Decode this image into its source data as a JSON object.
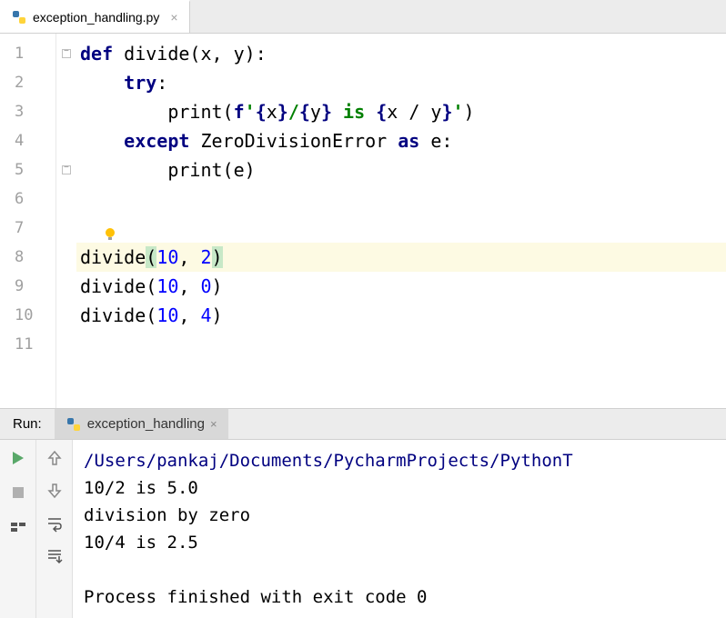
{
  "tabs": [
    {
      "label": "exception_handling.py"
    }
  ],
  "gutter_lines": [
    "1",
    "2",
    "3",
    "4",
    "5",
    "6",
    "7",
    "8",
    "9",
    "10",
    "11"
  ],
  "code": {
    "l1": {
      "def": "def",
      "name": "divide",
      "open": "(",
      "args": "x, y",
      "close": ")",
      "colon": ":"
    },
    "l2": {
      "try": "try",
      "colon": ":"
    },
    "l3": {
      "print": "print",
      "open": "(",
      "f": "f",
      "q1": "'",
      "br1": "{",
      "x": "x",
      "br2": "}",
      "slash": "/",
      "br3": "{",
      "y": "y",
      "br4": "}",
      "is": " is ",
      "br5": "{",
      "expr": "x / y",
      "br6": "}",
      "q2": "'",
      "close": ")"
    },
    "l4": {
      "except": "except",
      "exc": "ZeroDivisionError",
      "as": "as",
      "e": "e",
      "colon": ":"
    },
    "l5": {
      "print": "print",
      "open": "(",
      "e": "e",
      "close": ")"
    },
    "l8": {
      "call": "divide",
      "open": "(",
      "a": "10",
      "comma": ", ",
      "b": "2",
      "close": ")"
    },
    "l9": {
      "call": "divide",
      "open": "(",
      "a": "10",
      "comma": ", ",
      "b": "0",
      "close": ")"
    },
    "l10": {
      "call": "divide",
      "open": "(",
      "a": "10",
      "comma": ", ",
      "b": "4",
      "close": ")"
    }
  },
  "run": {
    "label": "Run:",
    "tab": "exception_handling",
    "output": {
      "path": "/Users/pankaj/Documents/PycharmProjects/PythonT",
      "line1": "10/2 is 5.0",
      "line2": "division by zero",
      "line3": "10/4 is 2.5",
      "proc": "Process finished with exit code 0"
    }
  }
}
